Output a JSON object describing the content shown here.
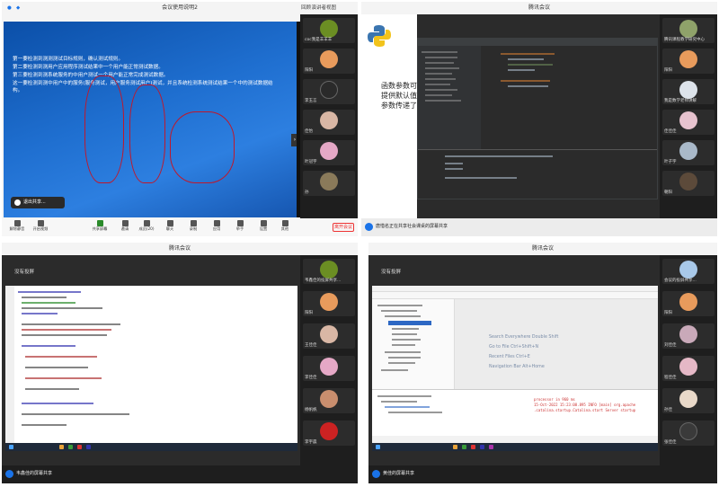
{
  "q1": {
    "title_bar_fragment": "会议使用说明2",
    "top_right": {
      "gallery": "回顾",
      "layout": "演讲者视图"
    },
    "slide_bullets": [
      "第一要检测到测测测试目标规则，确认测试规则。",
      "第二要检测到测用户应用程序测试结果中一个用户能正常测试数据。",
      "第三要检测到测系统服务的中用户测试一个用户能正常完成测试数据。",
      "这一要检测到测中用户中的服务(服务测试，用户服务测试用户)测试，并且系统检测系统测试结果一个中的测试数据结构。"
    ],
    "share_pill": "退出共享...",
    "toolbar": [
      "解除静音",
      "开启视频",
      "共享屏幕",
      "邀请",
      "成员(20)",
      "聊天",
      "录制",
      "应用",
      "举手",
      "设置",
      "其他"
    ],
    "end_button": "离开会议",
    "participants": [
      "coc我是羊羊羊",
      "阳阳",
      "李玉言",
      "佳怡",
      "叶冠宇",
      "孙"
    ]
  },
  "q2": {
    "title": "腾讯会议",
    "slide_text": [
      "函数参数可以",
      "提供默认值，",
      "参数传递了实"
    ],
    "share_label": "唐惜名正在共享社会课桌的屏幕共享",
    "participants": [
      "腾讯课程教学研究中心",
      "阳阳",
      "我是数学老师讲解",
      "佳佳佳",
      "叶子宇",
      "朝阳"
    ]
  },
  "q3": {
    "title": "腾讯会议",
    "header": "没有投屏",
    "share_label": "韦鑫佳的屏幕共享",
    "participants": [
      "韦鑫佳的投屏共享...",
      "阳阳",
      "王佳佳",
      "李佳佳",
      "杨帆帆",
      "李宇晨"
    ]
  },
  "q4": {
    "title": "腾讯会议",
    "header": "没有投屏",
    "hints": [
      "Search Everywhere Double Shift",
      "Go to File Ctrl+Shift+N",
      "Recent Files Ctrl+E",
      "Navigation Bar Alt+Home"
    ],
    "log_lines": [
      "processor in 960 ms",
      "15-Oct-2022 15:23:08.895 INFO [main] org.apache",
      ".catalina.startup.Catalina.start Server startup"
    ],
    "share_label": "黄佳的屏幕共享",
    "participants": [
      "会议的投屏共享...",
      "阳阳",
      "刘佳佳",
      "程佳佳",
      "孙佳",
      "张佳佳"
    ]
  },
  "colors": {
    "slide_blue": "#1f6fd0",
    "end_red": "#e33333",
    "accent": "#1a73e8"
  }
}
